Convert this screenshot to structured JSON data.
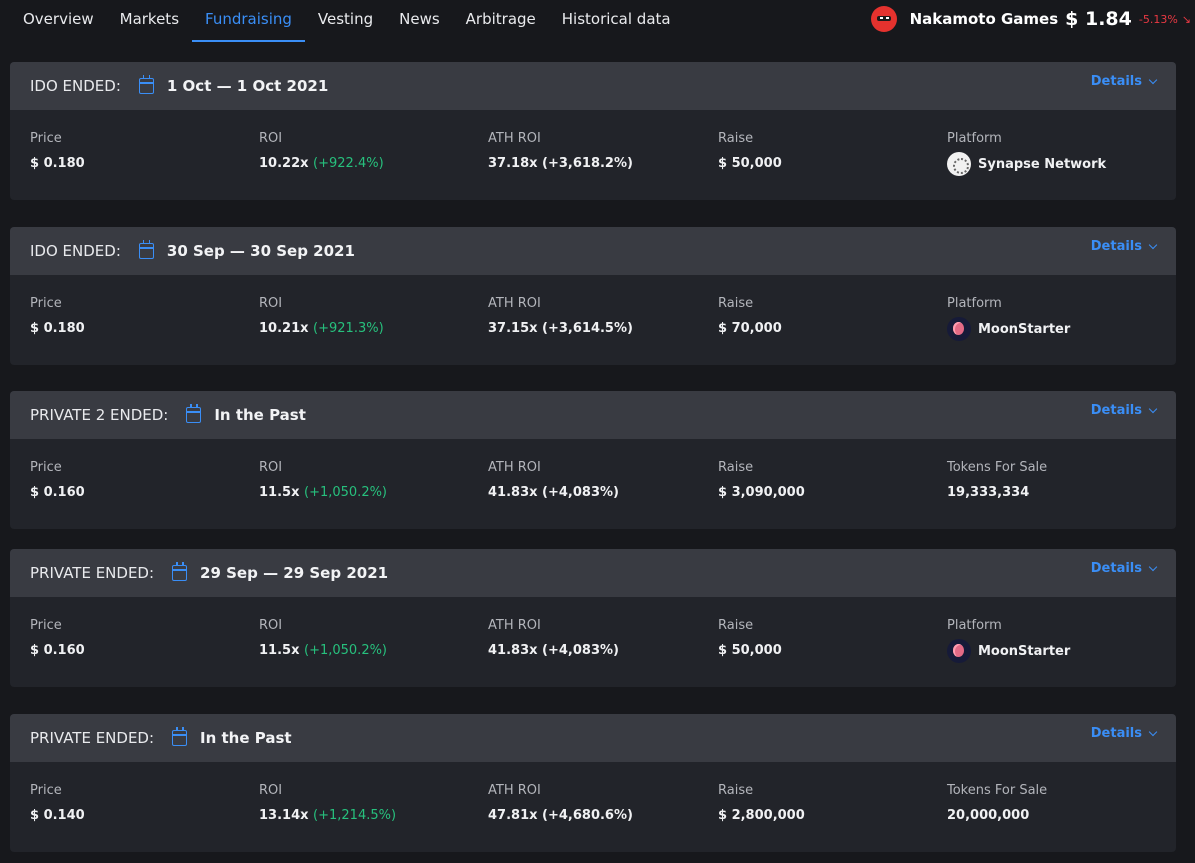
{
  "nav": {
    "tabs": [
      "Overview",
      "Markets",
      "Fundraising",
      "Vesting",
      "News",
      "Arbitrage",
      "Historical data"
    ],
    "active_tab": "Fundraising"
  },
  "token": {
    "name": "Nakamoto Games",
    "price": "$ 1.84",
    "change": "-5.13%",
    "change_arrow": "↘"
  },
  "colors": {
    "accent": "#3a8ef6",
    "positive": "#27c07d",
    "negative": "#ea3943",
    "header_bg": "#393b42",
    "card_bg": "#22242a",
    "page_bg": "#17181c"
  },
  "rounds": [
    {
      "label": "IDO ENDED:",
      "date": "1 Oct — 1 Oct 2021",
      "details": "Details",
      "price_label": "Price",
      "price": "$ 0.180",
      "roi_label": "ROI",
      "roi": "10.22x",
      "roi_pct": "(+922.4%)",
      "ath_label": "ATH ROI",
      "ath": "37.18x (+3,618.2%)",
      "raise_label": "Raise",
      "raise": "$ 50,000",
      "last_label": "Platform",
      "last_value": "Synapse Network",
      "platform_icon": "synapse-network-logo"
    },
    {
      "label": "IDO ENDED:",
      "date": "30 Sep — 30 Sep 2021",
      "details": "Details",
      "price_label": "Price",
      "price": "$ 0.180",
      "roi_label": "ROI",
      "roi": "10.21x",
      "roi_pct": "(+921.3%)",
      "ath_label": "ATH ROI",
      "ath": "37.15x (+3,614.5%)",
      "raise_label": "Raise",
      "raise": "$ 70,000",
      "last_label": "Platform",
      "last_value": "MoonStarter",
      "platform_icon": "moonstarter-logo"
    },
    {
      "label": "PRIVATE 2 ENDED:",
      "date": "In the Past",
      "details": "Details",
      "price_label": "Price",
      "price": "$ 0.160",
      "roi_label": "ROI",
      "roi": "11.5x",
      "roi_pct": "(+1,050.2%)",
      "ath_label": "ATH ROI",
      "ath": "41.83x (+4,083%)",
      "raise_label": "Raise",
      "raise": "$ 3,090,000",
      "last_label": "Tokens For Sale",
      "last_value": "19,333,334"
    },
    {
      "label": "PRIVATE ENDED:",
      "date": "29 Sep — 29 Sep 2021",
      "details": "Details",
      "price_label": "Price",
      "price": "$ 0.160",
      "roi_label": "ROI",
      "roi": "11.5x",
      "roi_pct": "(+1,050.2%)",
      "ath_label": "ATH ROI",
      "ath": "41.83x (+4,083%)",
      "raise_label": "Raise",
      "raise": "$ 50,000",
      "last_label": "Platform",
      "last_value": "MoonStarter",
      "platform_icon": "moonstarter-logo"
    },
    {
      "label": "PRIVATE ENDED:",
      "date": "In the Past",
      "details": "Details",
      "price_label": "Price",
      "price": "$ 0.140",
      "roi_label": "ROI",
      "roi": "13.14x",
      "roi_pct": "(+1,214.5%)",
      "ath_label": "ATH ROI",
      "ath": "47.81x (+4,680.6%)",
      "raise_label": "Raise",
      "raise": "$ 2,800,000",
      "last_label": "Tokens For Sale",
      "last_value": "20,000,000"
    }
  ]
}
